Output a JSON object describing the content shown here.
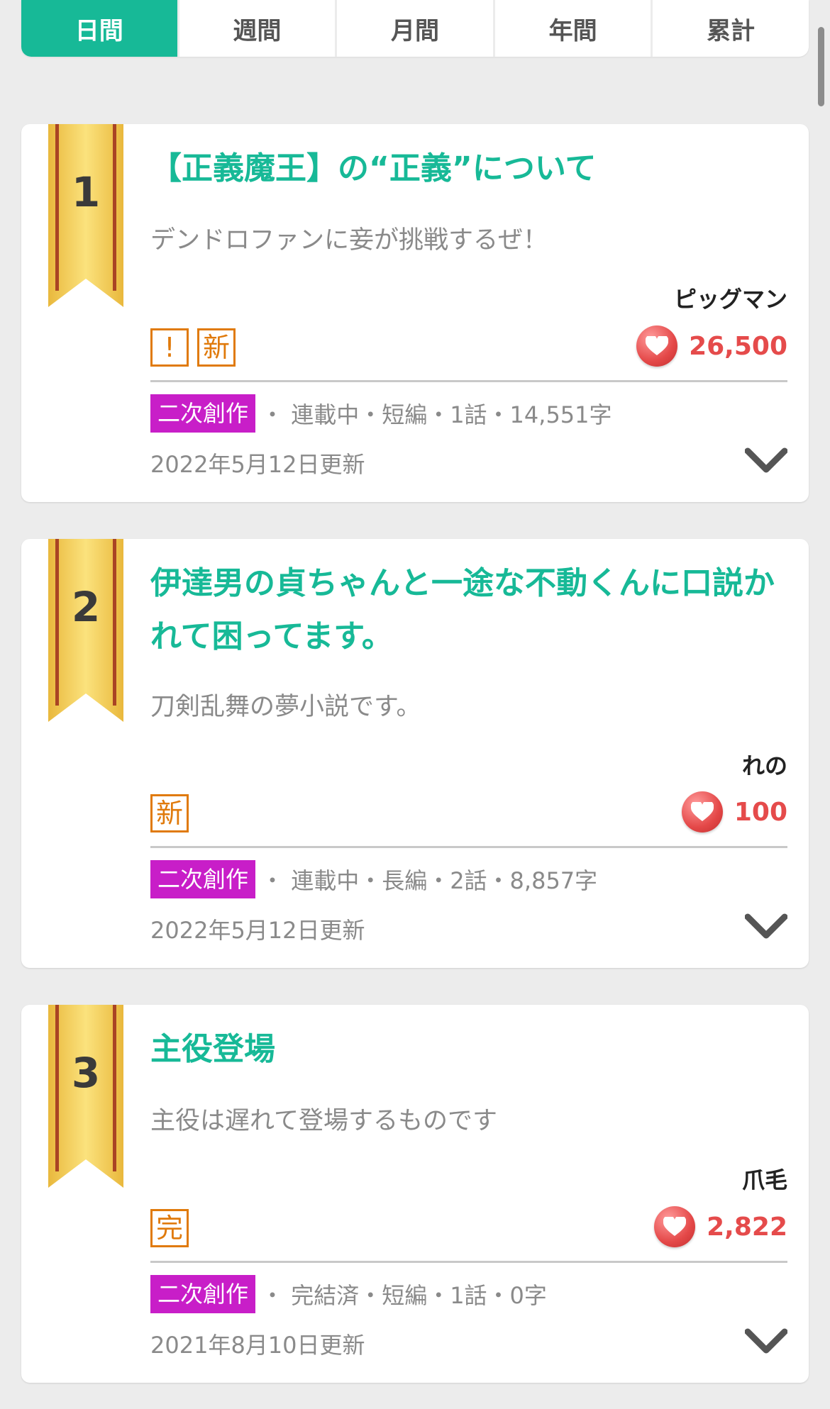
{
  "tabs": [
    {
      "label": "日間",
      "active": true
    },
    {
      "label": "週間",
      "active": false
    },
    {
      "label": "月間",
      "active": false
    },
    {
      "label": "年間",
      "active": false
    },
    {
      "label": "累計",
      "active": false
    }
  ],
  "colors": {
    "accent": "#17b997",
    "genre": "#c81ec8",
    "like": "#e54b4b",
    "badge": "#e07a0b",
    "ribbon": "#f3cc5c"
  },
  "rankings": [
    {
      "rank": "1",
      "title": "【正義魔王】の“正義”について",
      "summary": "デンドロファンに妾が挑戦するぜ！",
      "author": "ピッグマン",
      "badges": [
        "!",
        "新"
      ],
      "likes": "26,500",
      "genre": "二次創作",
      "meta": "・ 連載中・短編・1話・14,551字",
      "date": "2022年5月12日更新"
    },
    {
      "rank": "2",
      "title": "伊達男の貞ちゃんと一途な不動くんに口説かれて困ってます。",
      "summary": "刀剣乱舞の夢小説です。",
      "author": "れの",
      "badges": [
        "新"
      ],
      "likes": "100",
      "genre": "二次創作",
      "meta": "・ 連載中・長編・2話・8,857字",
      "date": "2022年5月12日更新"
    },
    {
      "rank": "3",
      "title": "主役登場",
      "summary": "主役は遅れて登場するものです",
      "author": "爪毛",
      "badges": [
        "完"
      ],
      "likes": "2,822",
      "genre": "二次創作",
      "meta": "・ 完結済・短編・1話・0字",
      "date": "2021年8月10日更新"
    }
  ]
}
